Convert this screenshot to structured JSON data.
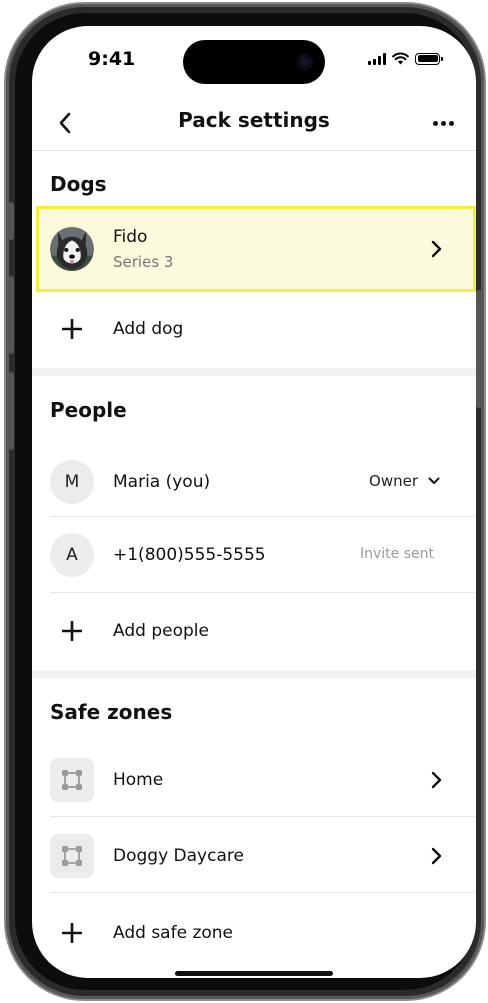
{
  "status_bar": {
    "time": "9:41"
  },
  "header": {
    "title": "Pack settings"
  },
  "dogs": {
    "section_title": "Dogs",
    "items": [
      {
        "name": "Fido",
        "subtitle": "Series 3"
      }
    ],
    "add_label": "Add dog"
  },
  "people": {
    "section_title": "People",
    "items": [
      {
        "initial": "M",
        "name": "Maria (you)",
        "role": "Owner"
      },
      {
        "initial": "A",
        "name": "+1(800)555-5555",
        "status": "Invite sent"
      }
    ],
    "add_label": "Add people"
  },
  "safe_zones": {
    "section_title": "Safe zones",
    "items": [
      {
        "name": "Home"
      },
      {
        "name": "Doggy Daycare"
      }
    ],
    "add_label": "Add safe zone"
  },
  "colors": {
    "highlight_fill": "#fbfadd",
    "highlight_border": "#f2ee3a",
    "secondary_text": "#777777"
  },
  "icons": [
    "back-chevron-icon",
    "more-icon",
    "chevron-right-icon",
    "plus-icon",
    "chevron-down-icon",
    "zone-polygon-icon"
  ]
}
